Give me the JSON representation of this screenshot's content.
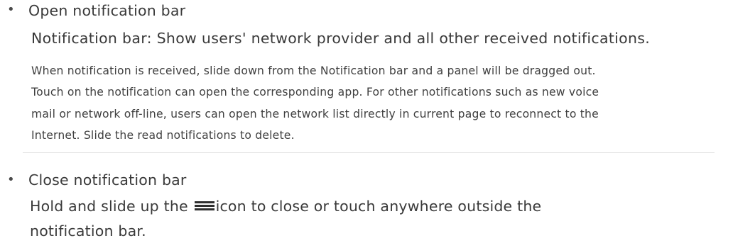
{
  "open_section": {
    "bullet": "•",
    "heading": "Open notification bar",
    "bar_title": "Notification bar: Show users' network provider and all other received notifications.",
    "paragraph_lines": [
      "When notification is received, slide down from the Notification bar and a panel will be dragged out.",
      "Touch on the notification can open the corresponding app. For other notifications such as new voice",
      "mail or network off-line, users can open the network list directly in current page to reconnect to the",
      "Internet. Slide the read notifications to delete."
    ]
  },
  "close_section": {
    "bullet": "•",
    "heading": "Close notification bar",
    "line1_before_icon": "Hold and slide up the",
    "icon_name": "menu-lines-icon",
    "line1_after_icon": "icon to close or touch anywhere outside the",
    "line2": "notification bar."
  }
}
